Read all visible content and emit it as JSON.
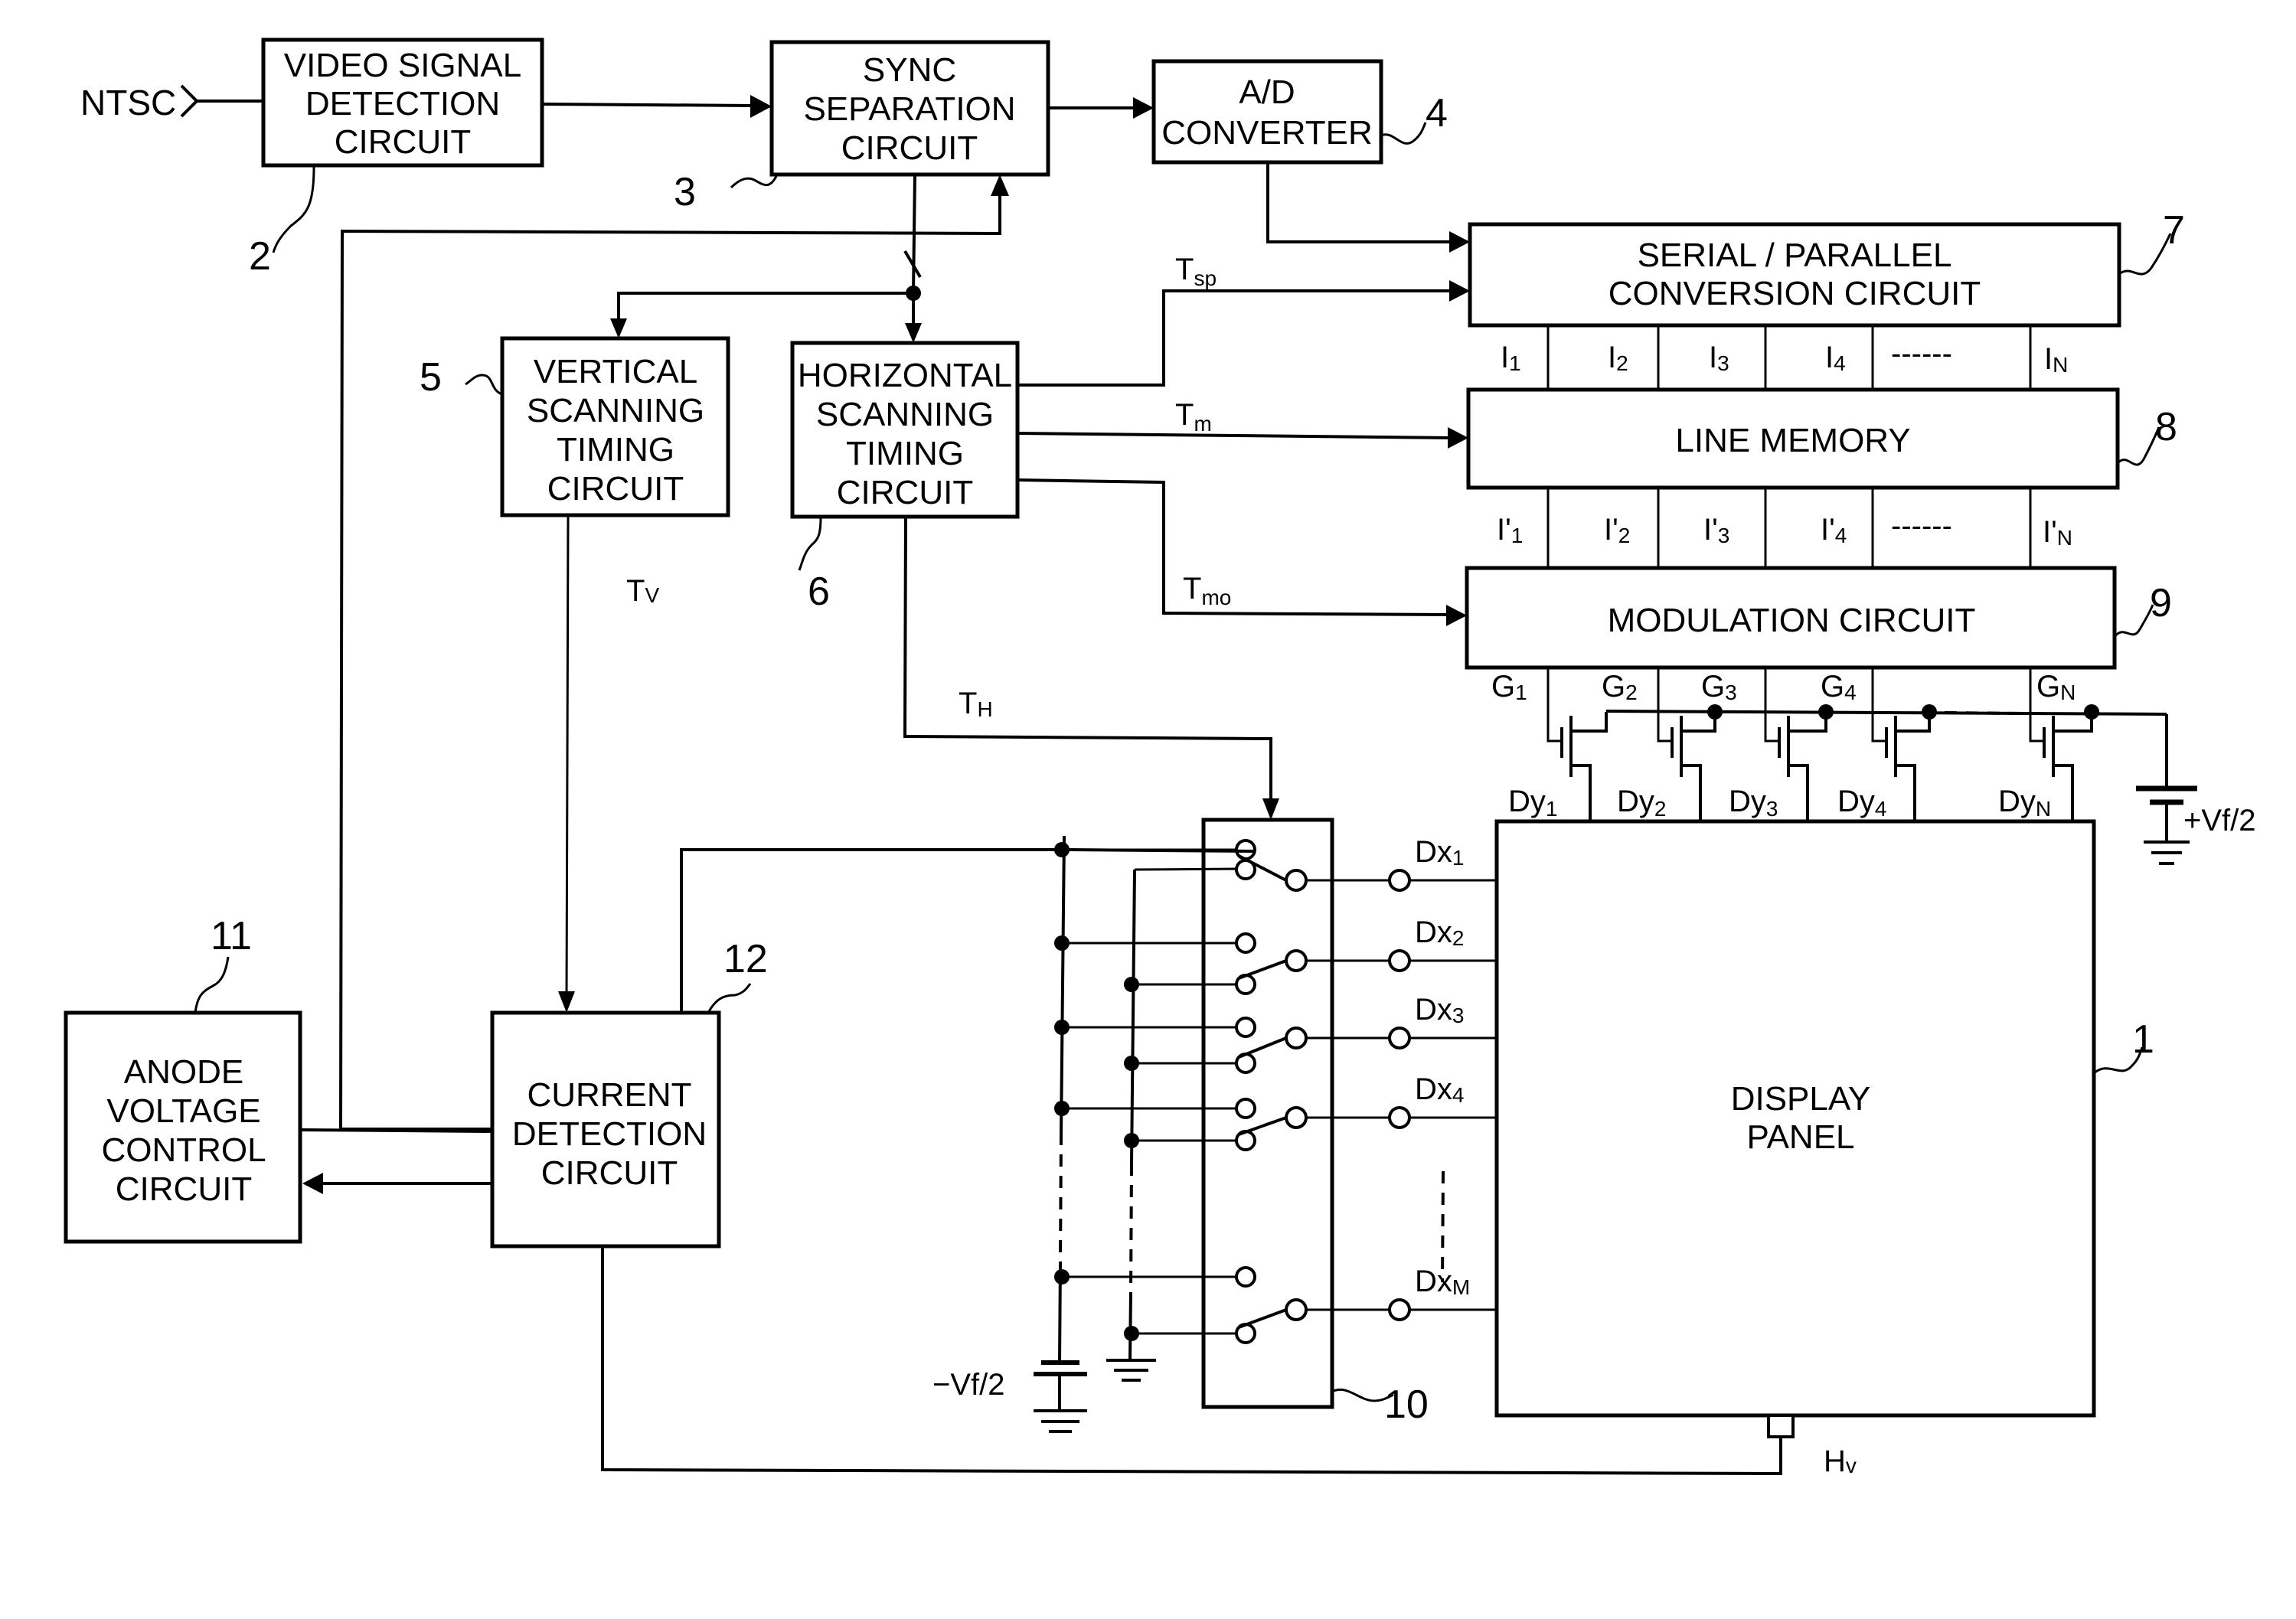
{
  "figure": {
    "type": "block-diagram",
    "subject": "Display panel drive circuit"
  },
  "input": {
    "label": "NTSC"
  },
  "blocks": {
    "video_signal_detection": {
      "lines": [
        "VIDEO SIGNAL",
        "DETECTION",
        "CIRCUIT"
      ],
      "ref": "2"
    },
    "sync_separation": {
      "lines": [
        "SYNC",
        "SEPARATION",
        "CIRCUIT"
      ],
      "ref": "3"
    },
    "ad_converter": {
      "lines": [
        "A/D",
        "CONVERTER"
      ],
      "ref": "4"
    },
    "vertical_scanning": {
      "lines": [
        "VERTICAL",
        "SCANNING",
        "TIMING",
        "CIRCUIT"
      ],
      "ref": "5"
    },
    "horizontal_scanning": {
      "lines": [
        "HORIZONTAL",
        "SCANNING",
        "TIMING",
        "CIRCUIT"
      ],
      "ref": "6"
    },
    "serial_parallel": {
      "lines": [
        "SERIAL / PARALLEL",
        "CONVERSION CIRCUIT"
      ],
      "ref": "7"
    },
    "line_memory": {
      "lines": [
        "LINE MEMORY"
      ],
      "ref": "8"
    },
    "modulation": {
      "lines": [
        "MODULATION CIRCUIT"
      ],
      "ref": "9"
    },
    "switch_array": {
      "ref": "10"
    },
    "anode_voltage_control": {
      "lines": [
        "ANODE",
        "VOLTAGE",
        "CONTROL",
        "CIRCUIT"
      ],
      "ref": "11"
    },
    "current_detection": {
      "lines": [
        "CURRENT",
        "DETECTION",
        "CIRCUIT"
      ],
      "ref": "12"
    },
    "display_panel": {
      "lines": [
        "DISPLAY",
        "PANEL"
      ],
      "ref": "1"
    }
  },
  "signals": {
    "tsp": {
      "main": "T",
      "sub": "sp"
    },
    "tm": {
      "main": "T",
      "sub": "m"
    },
    "tmo": {
      "main": "T",
      "sub": "mo"
    },
    "tv": {
      "main": "T",
      "sub": "V"
    },
    "th": {
      "main": "T",
      "sub": "H"
    },
    "hv": {
      "main": "H",
      "sub": "v"
    }
  },
  "parallel_outputs": [
    {
      "main": "I",
      "sub": "1"
    },
    {
      "main": "I",
      "sub": "2"
    },
    {
      "main": "I",
      "sub": "3"
    },
    {
      "main": "I",
      "sub": "4"
    },
    {
      "main": "------",
      "sub": ""
    },
    {
      "main": "I",
      "sub": "N"
    }
  ],
  "memory_outputs": [
    {
      "main": "I'",
      "sub": "1"
    },
    {
      "main": "I'",
      "sub": "2"
    },
    {
      "main": "I'",
      "sub": "3"
    },
    {
      "main": "I'",
      "sub": "4"
    },
    {
      "main": "------",
      "sub": ""
    },
    {
      "main": "I'",
      "sub": "N"
    }
  ],
  "gate_lines": [
    {
      "main": "G",
      "sub": "1"
    },
    {
      "main": "G",
      "sub": "2"
    },
    {
      "main": "G",
      "sub": "3"
    },
    {
      "main": "G",
      "sub": "4"
    },
    {
      "main": "G",
      "sub": "N"
    }
  ],
  "column_lines": [
    {
      "main": "Dy",
      "sub": "1"
    },
    {
      "main": "Dy",
      "sub": "2"
    },
    {
      "main": "Dy",
      "sub": "3"
    },
    {
      "main": "Dy",
      "sub": "4"
    },
    {
      "main": "Dy",
      "sub": "N"
    }
  ],
  "row_lines": [
    {
      "main": "Dx",
      "sub": "1"
    },
    {
      "main": "Dx",
      "sub": "2"
    },
    {
      "main": "Dx",
      "sub": "3"
    },
    {
      "main": "Dx",
      "sub": "4"
    },
    {
      "main": "Dx",
      "sub": "M"
    }
  ],
  "supplies": {
    "positive": "+Vf/2",
    "negative": "−Vf/2"
  }
}
